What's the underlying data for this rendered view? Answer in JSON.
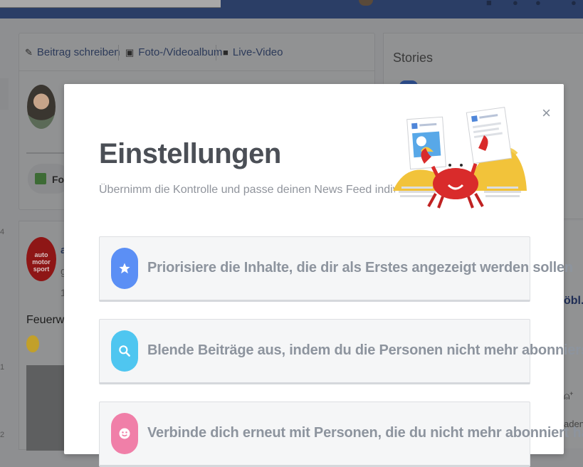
{
  "composer": {
    "tabs": [
      {
        "label": "Beitrag schreiben"
      },
      {
        "label": "Foto-/Videoalbum"
      },
      {
        "label": "Live-Video"
      }
    ],
    "photo_button_label": "Foto"
  },
  "left_column": {
    "numbers": [
      "4",
      "1",
      "2"
    ]
  },
  "post": {
    "logo_text": "auto motor sport",
    "author_initial": "a",
    "meta": "g",
    "time": "1",
    "text": "Feuerwe"
  },
  "stories": {
    "title": "Stories"
  },
  "right_panel": {
    "link_text": "öbl..",
    "label": "aden"
  },
  "modal": {
    "title": "Einstellungen",
    "subtitle": "Übernimm die Kontrolle und passe deinen News Feed individuell an",
    "close_label": "×",
    "options": [
      {
        "label": "Priorisiere die Inhalte, die dir als Erstes angezeigt werden sollen",
        "icon": "star-icon",
        "color": "#5b8ff5"
      },
      {
        "label": "Blende Beiträge aus, indem du die Personen nicht mehr abonnierst",
        "icon": "search-icon",
        "color": "#4fc6f0"
      },
      {
        "label": "Verbinde dich erneut mit Personen, die du nicht mehr abonniert hast",
        "icon": "smiley-icon",
        "color": "#f07fa8"
      }
    ]
  }
}
